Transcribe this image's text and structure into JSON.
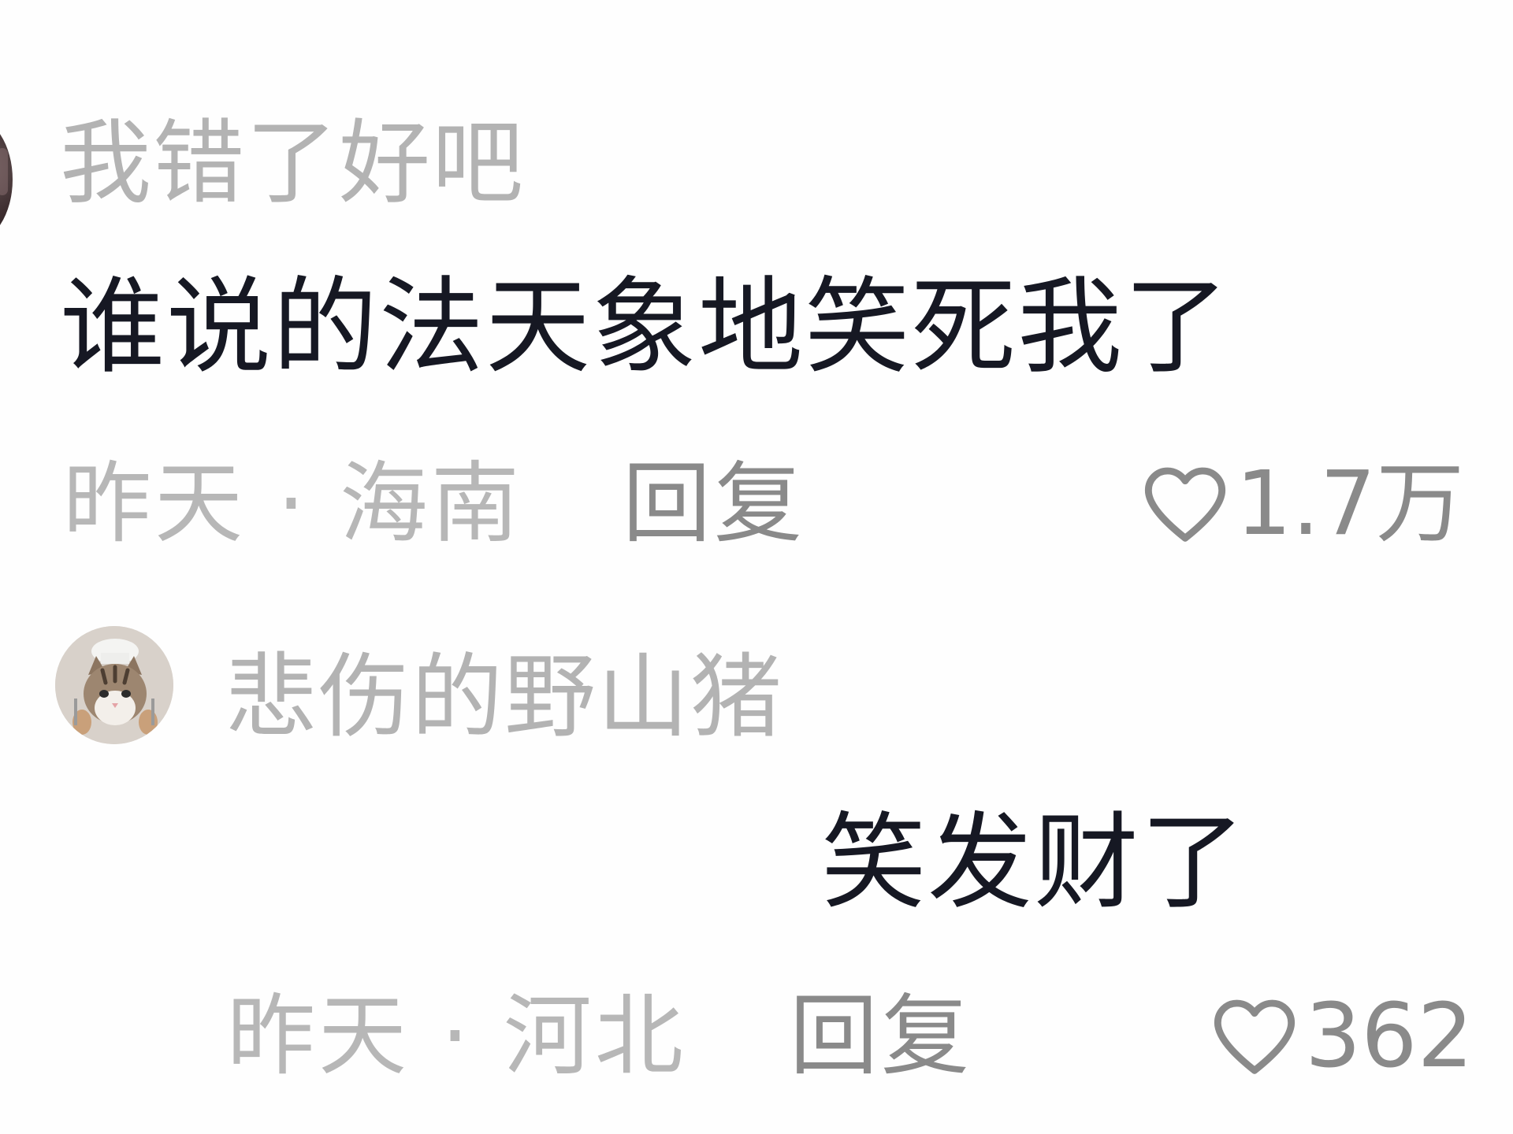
{
  "comments": [
    {
      "username": "我错了好吧",
      "content": "谁说的法天象地笑死我了",
      "time": "昨天",
      "separator": "·",
      "location": "海南",
      "reply_label": "回复",
      "likes": "1.7万",
      "avatar_icon": "user-avatar"
    },
    {
      "username": "悲伤的野山猪",
      "content": "笑发财了",
      "time": "昨天",
      "separator": "·",
      "location": "河北",
      "reply_label": "回复",
      "likes": "362",
      "avatar_icon": "cat-chef-avatar"
    }
  ],
  "colors": {
    "background": "#fefefe",
    "username": "#b3b3b3",
    "content": "#161823",
    "meta": "#b7b7b7",
    "action": "#8a8a8a"
  }
}
